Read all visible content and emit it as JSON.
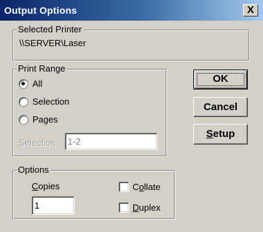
{
  "window": {
    "title": "Output Options",
    "close_glyph": "X"
  },
  "printer": {
    "group_label": "Selected Printer",
    "name": "\\\\SERVER\\Laser"
  },
  "print_range": {
    "group_label": "Print Range",
    "options": [
      {
        "label": "All",
        "checked": true
      },
      {
        "label": "Selection",
        "checked": false
      },
      {
        "label": "Pages",
        "checked": false
      }
    ],
    "selection_label": "Selection",
    "selection_value": "1-2"
  },
  "options": {
    "group_label": "Options",
    "copies_label_first": "C",
    "copies_label_rest": "opies",
    "copies_value": "1",
    "collate_label_first": "C",
    "collate_label_u": "o",
    "collate_label_rest": "llate",
    "duplex_label_u": "D",
    "duplex_label_rest": "uplex"
  },
  "buttons": {
    "ok": "OK",
    "cancel": "Cancel",
    "setup_u": "S",
    "setup_rest": "etup"
  }
}
